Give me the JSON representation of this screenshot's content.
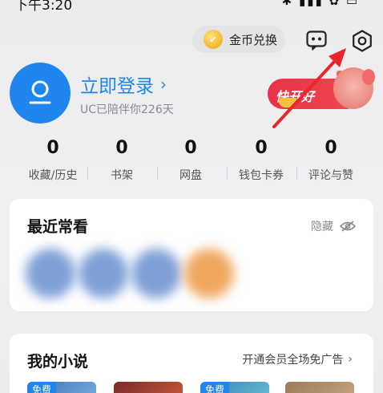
{
  "status_bar": {
    "time": "下午3:20",
    "icons_text": "✱ ▮▮▮ ✿ ▭"
  },
  "header": {
    "coin_exchange_label": "金币兑换",
    "coin_icon_glyph": "✔",
    "message_icon": "message-dots-icon",
    "settings_icon": "gear-icon"
  },
  "profile": {
    "login_label": "立即登录",
    "login_chevron": "›",
    "accompany_text": "UC已陪伴你226天",
    "avatar_icon": "user-avatar-icon"
  },
  "promo": {
    "text": "快开好"
  },
  "stats": [
    {
      "value": "0",
      "label": "收藏/历史"
    },
    {
      "value": "0",
      "label": "书架"
    },
    {
      "value": "0",
      "label": "网盘"
    },
    {
      "value": "0",
      "label": "钱包卡券"
    },
    {
      "value": "0",
      "label": "评论与赞"
    }
  ],
  "recent": {
    "title": "最近常看",
    "hide_label": "隐藏",
    "hide_icon": "eye-off-icon",
    "items_colors": [
      "#7fa0d6",
      "#7fa0d6",
      "#7fa0d6",
      "#f0a860"
    ]
  },
  "novels": {
    "title": "我的小说",
    "vip_label": "开通会员全场免广告",
    "vip_chevron": "›",
    "free_tag": "免费"
  },
  "colors": {
    "accent": "#1f86f0",
    "promo_red": "#e8324a",
    "arrow_red": "#e8262c"
  }
}
